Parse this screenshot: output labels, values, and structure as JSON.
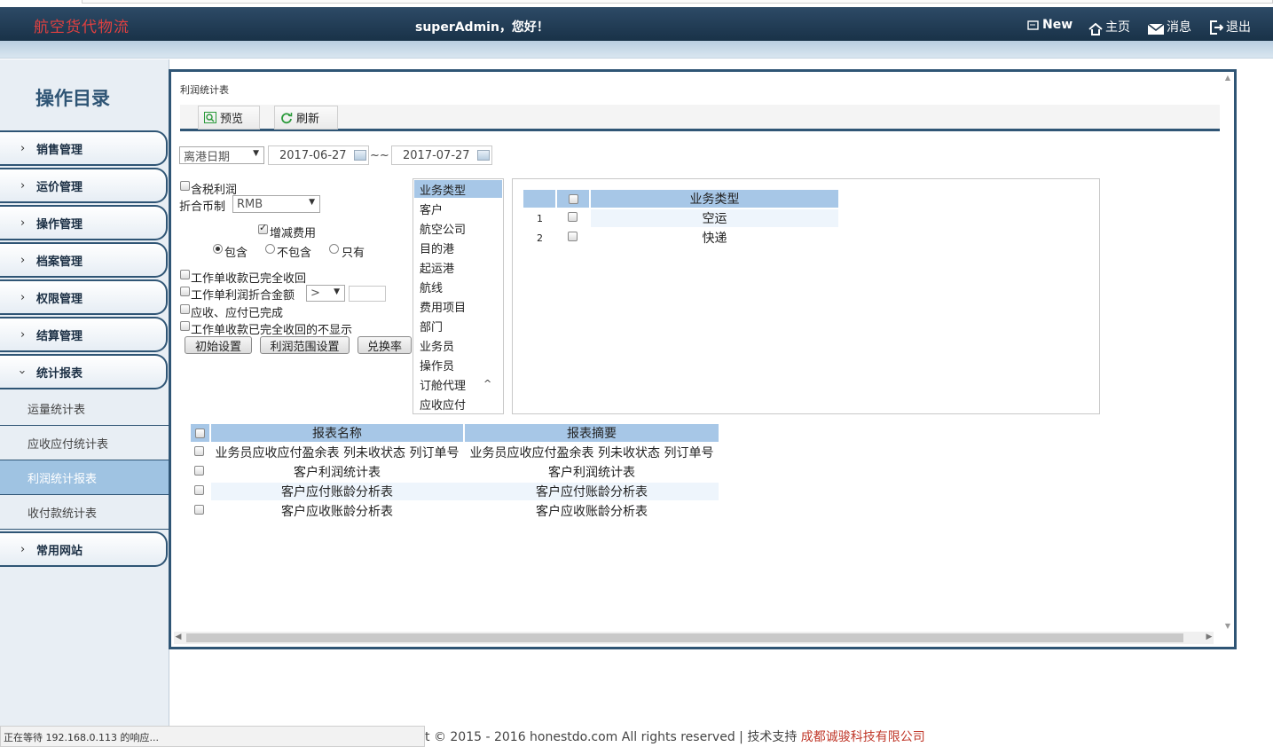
{
  "header": {
    "logo": "航空货代物流",
    "greeting": "superAdmin，您好！",
    "links": [
      {
        "label": "New",
        "icon": "new-window-icon"
      },
      {
        "label": "主页",
        "icon": "home-icon"
      },
      {
        "label": "消息",
        "icon": "mail-icon"
      },
      {
        "label": "退出",
        "icon": "logout-icon"
      }
    ]
  },
  "sidebar": {
    "title": "操作目录",
    "menus": [
      "销售管理",
      "运价管理",
      "操作管理",
      "档案管理",
      "权限管理",
      "结算管理",
      "统计报表",
      "常用网站"
    ],
    "submenus": [
      "运量统计表",
      "应收应付统计表",
      "利润统计报表",
      "收付款统计表"
    ],
    "active_submenu": "利润统计报表"
  },
  "panel": {
    "breadcrumb": "利润统计表",
    "toolbar": {
      "preview": "预览",
      "refresh": "刷新"
    },
    "filters": {
      "date_type": "离港日期",
      "date_from": "2017-06-27",
      "date_sep": "~~",
      "date_to": "2017-07-27",
      "tax_profit": "含税利润",
      "currency_label": "折合币制",
      "currency": "RMB",
      "adjust_fee": "增减费用",
      "radio_include": "包含",
      "radio_exclude": "不包含",
      "radio_only": "只有",
      "opt_fully_collected": "工作单收款已完全收回",
      "opt_profit_amount": "工作单利润折合金额",
      "operator": ">",
      "opt_ar_ap_done": "应收、应付已完成",
      "opt_hide_collected": "工作单收款已完全收回的不显示",
      "btn_init": "初始设置",
      "btn_range": "利润范围设置",
      "btn_rate": "兑换率"
    },
    "dimension_list": [
      "业务类型",
      "客户",
      "航空公司",
      "目的港",
      "起运港",
      "航线",
      "费用项目",
      "部门",
      "业务员",
      "操作员",
      "订舱代理",
      "应收应付"
    ],
    "type_table": {
      "header": "业务类型",
      "rows": [
        {
          "no": "1",
          "name": "空运"
        },
        {
          "no": "2",
          "name": "快递"
        }
      ]
    },
    "report_table": {
      "headers": [
        "报表名称",
        "报表摘要"
      ],
      "rows": [
        {
          "name": "业务员应收应付盈余表 列未收状态 列订单号",
          "summary": "业务员应收应付盈余表 列未收状态 列订单号"
        },
        {
          "name": "客户利润统计表",
          "summary": "客户利润统计表"
        },
        {
          "name": "客户应付账龄分析表",
          "summary": "客户应付账龄分析表"
        },
        {
          "name": "客户应收账龄分析表",
          "summary": "客户应收账龄分析表"
        }
      ]
    }
  },
  "status_bar": "正在等待 192.168.0.113 的响应...",
  "footer": {
    "copyright": "t © 2015 - 2016 honestdo.com All rights reserved | 技术支持 ",
    "company": "成都诚骏科技有限公司"
  }
}
